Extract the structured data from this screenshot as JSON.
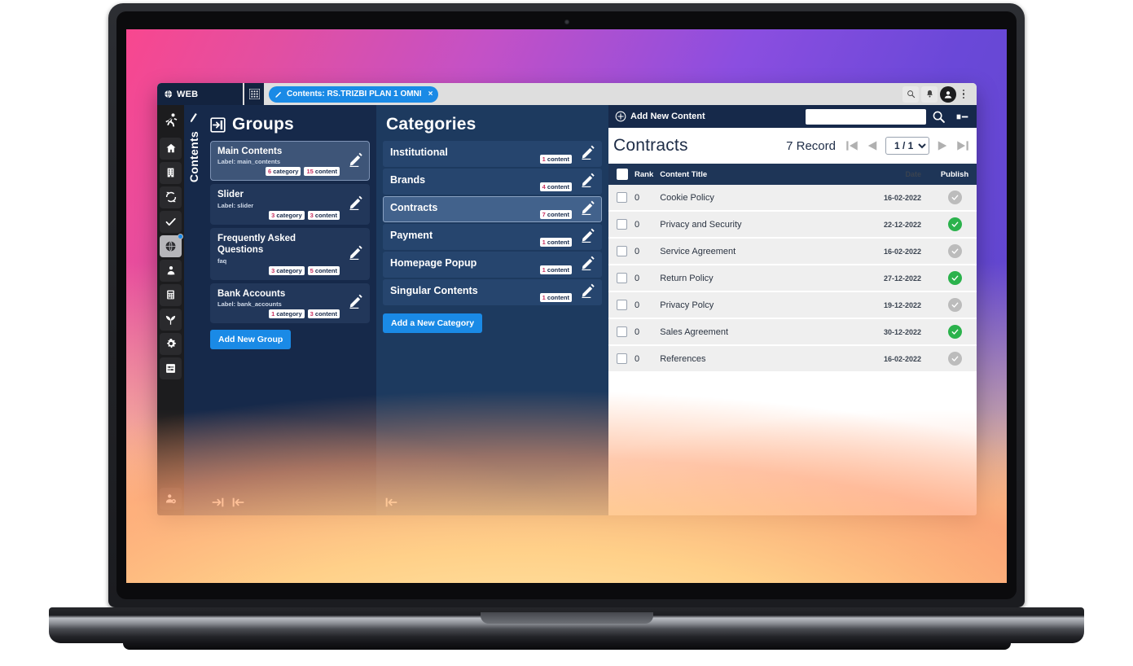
{
  "browser": {
    "web_button_label": "WEB",
    "web_icon": "globe-icon",
    "grid_icon": "grid-apps-icon",
    "tab": {
      "icon": "pencil-icon",
      "label": "Contents: RS.TRIZBI PLAN 1 OMNI",
      "close": "×"
    },
    "controls": {
      "search_icon": "search-icon",
      "bell_icon": "bell-icon",
      "avatar_icon": "user-avatar-icon",
      "menu_icon": "kebab-menu-icon"
    }
  },
  "rail": {
    "logo_icon": "running-person-logo-icon",
    "items": [
      {
        "icon": "home-icon",
        "active": false
      },
      {
        "icon": "building-icon",
        "active": false
      },
      {
        "icon": "sync-refresh-icon",
        "active": false
      },
      {
        "icon": "check-icon",
        "active": false
      },
      {
        "icon": "globe-icon",
        "active": true
      },
      {
        "icon": "user-icon",
        "active": false
      },
      {
        "icon": "calculator-icon",
        "active": false
      },
      {
        "icon": "sprout-icon",
        "active": false
      },
      {
        "icon": "gear-icon",
        "active": false
      },
      {
        "icon": "sliders-icon",
        "active": false
      }
    ],
    "bottom_icon": "user-settings-icon"
  },
  "vertical_strip": {
    "icon": "pencil-icon",
    "label": "Contents"
  },
  "groups_panel": {
    "header_icon": "panel-collapse-in-icon",
    "title": "Groups",
    "items": [
      {
        "name": "Main Contents",
        "label": "Label: main_contents",
        "categories": "6",
        "categories_unit": "category",
        "contents": "15",
        "contents_unit": "content",
        "active": true
      },
      {
        "name": "Slider",
        "label": "Label: slider",
        "categories": "3",
        "categories_unit": "category",
        "contents": "3",
        "contents_unit": "content",
        "active": false
      },
      {
        "name": "Frequently Asked Questions",
        "label": "faq",
        "categories": "3",
        "categories_unit": "category",
        "contents": "5",
        "contents_unit": "content",
        "active": false
      },
      {
        "name": "Bank Accounts",
        "label": "Label: bank_accounts",
        "categories": "1",
        "categories_unit": "category",
        "contents": "3",
        "contents_unit": "content",
        "active": false
      }
    ],
    "add_button": "Add New Group",
    "foot_icons": [
      "arrow-right-to-bar-icon",
      "arrow-left-to-bar-icon"
    ]
  },
  "categories_panel": {
    "title": "Categories",
    "items": [
      {
        "name": "Institutional",
        "count": "1",
        "unit": "content",
        "active": false
      },
      {
        "name": "Brands",
        "count": "4",
        "unit": "content",
        "active": false
      },
      {
        "name": "Contracts",
        "count": "7",
        "unit": "content",
        "active": true
      },
      {
        "name": "Payment",
        "count": "1",
        "unit": "content",
        "active": false
      },
      {
        "name": "Homepage Popup",
        "count": "1",
        "unit": "content",
        "active": false
      },
      {
        "name": "Singular Contents",
        "count": "1",
        "unit": "content",
        "active": false
      }
    ],
    "add_button": "Add a New Category",
    "foot_icon": "arrow-left-to-bar-icon"
  },
  "main": {
    "add_content_label": "Add New Content",
    "add_content_icon": "plus-circle-icon",
    "search_value": "",
    "search_placeholder": "",
    "search_icon": "search-icon",
    "panel_toggle_icon": "panel-collapse-icon",
    "page_title": "Contracts",
    "record_count_label": "7 Record",
    "pager": {
      "first_icon": "first-page-icon",
      "prev_icon": "prev-page-icon",
      "current": "1 / 1",
      "options": [
        "1 / 1"
      ],
      "next_icon": "next-page-icon",
      "last_icon": "last-page-icon"
    },
    "table": {
      "columns": [
        "Rank",
        "Content Title",
        "Date",
        "Publish"
      ],
      "rows": [
        {
          "rank": "0",
          "title": "Cookie Policy",
          "date": "16-02-2022",
          "published": false
        },
        {
          "rank": "0",
          "title": "Privacy and Security",
          "date": "22-12-2022",
          "published": true
        },
        {
          "rank": "0",
          "title": "Service Agreement",
          "date": "16-02-2022",
          "published": false
        },
        {
          "rank": "0",
          "title": "Return Policy",
          "date": "27-12-2022",
          "published": true
        },
        {
          "rank": "0",
          "title": "Privacy Polcy",
          "date": "19-12-2022",
          "published": false
        },
        {
          "rank": "0",
          "title": "Sales Agreement",
          "date": "30-12-2022",
          "published": true
        },
        {
          "rank": "0",
          "title": "References",
          "date": "16-02-2022",
          "published": false
        }
      ]
    }
  },
  "colors": {
    "accent_blue": "#1a8ae6",
    "panel_dark": "#16294a",
    "panel_mid": "#1d3a5f",
    "status_on": "#2bb24c",
    "status_off": "#bcbcbc",
    "badge_number": "#c8305f"
  }
}
